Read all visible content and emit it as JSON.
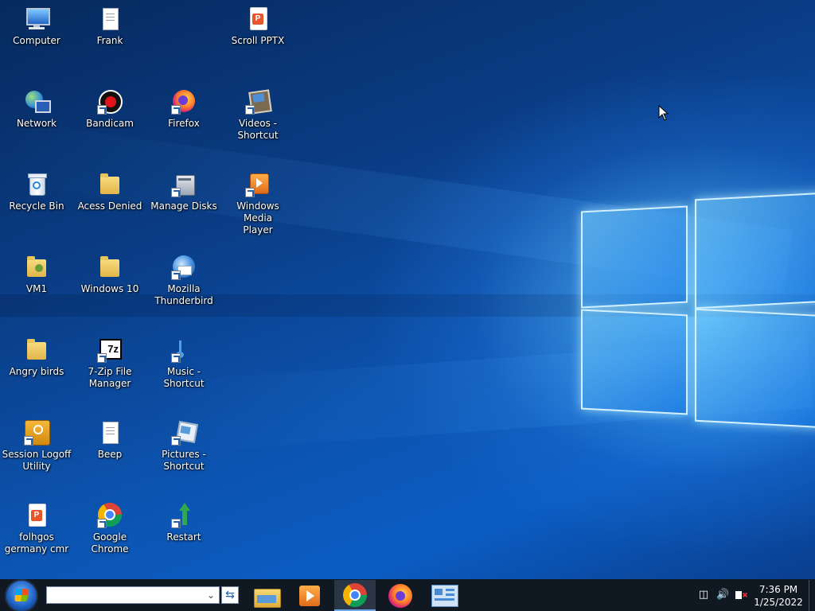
{
  "desktop": {
    "icons": [
      {
        "label": "Computer",
        "icon": "computer-icon"
      },
      {
        "label": "Frank",
        "icon": "text-document-icon"
      },
      {
        "label": "Scroll PPTX",
        "icon": "powerpoint-file-icon"
      },
      {
        "label": "Network",
        "icon": "network-globe-icon"
      },
      {
        "label": "Bandicam",
        "icon": "bandicam-record-icon"
      },
      {
        "label": "Firefox",
        "icon": "firefox-icon"
      },
      {
        "label": "Videos -\nShortcut",
        "icon": "videos-library-icon"
      },
      {
        "label": "Recycle Bin",
        "icon": "recycle-bin-icon"
      },
      {
        "label": "Acess Denied",
        "icon": "folder-icon"
      },
      {
        "label": "Manage Disks",
        "icon": "disk-management-icon"
      },
      {
        "label": "Windows Media\nPlayer",
        "icon": "media-player-icon"
      },
      {
        "label": "VM1",
        "icon": "user-folder-icon"
      },
      {
        "label": "Windows 10",
        "icon": "folder-icon"
      },
      {
        "label": "Mozilla\nThunderbird",
        "icon": "thunderbird-icon"
      },
      {
        "label": "Angry birds",
        "icon": "folder-icon"
      },
      {
        "label": "7-Zip File\nManager",
        "icon": "7zip-icon"
      },
      {
        "label": "Music - Shortcut",
        "icon": "music-library-icon"
      },
      {
        "label": "Session Logoff\nUtility",
        "icon": "logoff-utility-icon"
      },
      {
        "label": "Beep",
        "icon": "text-document-icon"
      },
      {
        "label": "Pictures -\nShortcut",
        "icon": "pictures-library-icon"
      },
      {
        "label": "folhgos\ngermany cmr",
        "icon": "powerpoint-file-icon"
      },
      {
        "label": "Google Chrome",
        "icon": "chrome-icon"
      },
      {
        "label": "Restart",
        "icon": "restart-arrow-icon"
      }
    ]
  },
  "taskbar": {
    "search_value": "",
    "pinned": [
      {
        "name": "file-explorer",
        "icon": "file-explorer-icon",
        "active": false
      },
      {
        "name": "media-player",
        "icon": "media-player-icon",
        "active": false
      },
      {
        "name": "chrome",
        "icon": "chrome-icon",
        "active": true
      },
      {
        "name": "firefox",
        "icon": "firefox-icon",
        "active": false
      },
      {
        "name": "control-panel",
        "icon": "control-panel-icon",
        "active": false
      }
    ],
    "tray": [
      "network-icon",
      "volume-icon",
      "action-center-flag-icon"
    ],
    "time": "7:36 PM",
    "date": "1/25/2022"
  },
  "colors": {
    "taskbar_bg": "#101822",
    "desktop_dark": "#062a5e",
    "desktop_light": "#0b5dc4"
  }
}
